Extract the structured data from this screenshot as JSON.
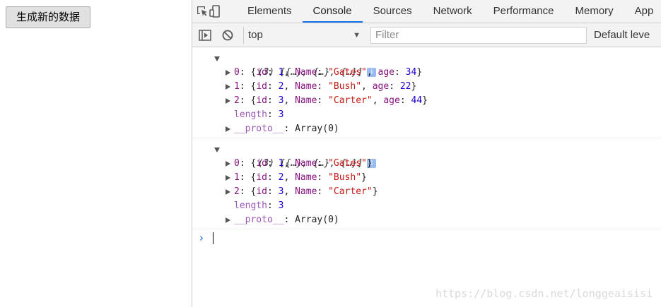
{
  "page": {
    "button_label": "生成新的数据"
  },
  "devtools": {
    "tabs": [
      "Elements",
      "Console",
      "Sources",
      "Network",
      "Performance",
      "Memory",
      "App"
    ],
    "active_tab": "Console",
    "toolbar": {
      "context": "top",
      "filter_placeholder": "Filter",
      "levels": "Default leve"
    },
    "console": {
      "messages": [
        {
          "summary": "(3) [{…}, {…}, {…}]",
          "info_badge": "i",
          "rows": [
            {
              "index": "0",
              "id": "1",
              "Name": "\"Gates\"",
              "age": "34"
            },
            {
              "index": "1",
              "id": "2",
              "Name": "\"Bush\"",
              "age": "22"
            },
            {
              "index": "2",
              "id": "3",
              "Name": "\"Carter\"",
              "age": "44"
            }
          ],
          "length_key": "length",
          "length_value": "3",
          "proto_key": "__proto__",
          "proto_value": "Array(0)"
        },
        {
          "summary": "(3) [{…}, {…}, {…}]",
          "info_badge": "i",
          "rows": [
            {
              "index": "0",
              "id": "1",
              "Name": "\"Gates\""
            },
            {
              "index": "1",
              "id": "2",
              "Name": "\"Bush\""
            },
            {
              "index": "2",
              "id": "3",
              "Name": "\"Carter\""
            }
          ],
          "length_key": "length",
          "length_value": "3",
          "proto_key": "__proto__",
          "proto_value": "Array(0)"
        }
      ],
      "prompt": "›"
    }
  },
  "watermark": "https://blog.csdn.net/longgeaisisi",
  "colors": {
    "accent": "#1a73e8",
    "property_key": "#881280",
    "number": "#1c00cf",
    "string": "#c41a16",
    "info_badge": "#9bbcf0"
  }
}
